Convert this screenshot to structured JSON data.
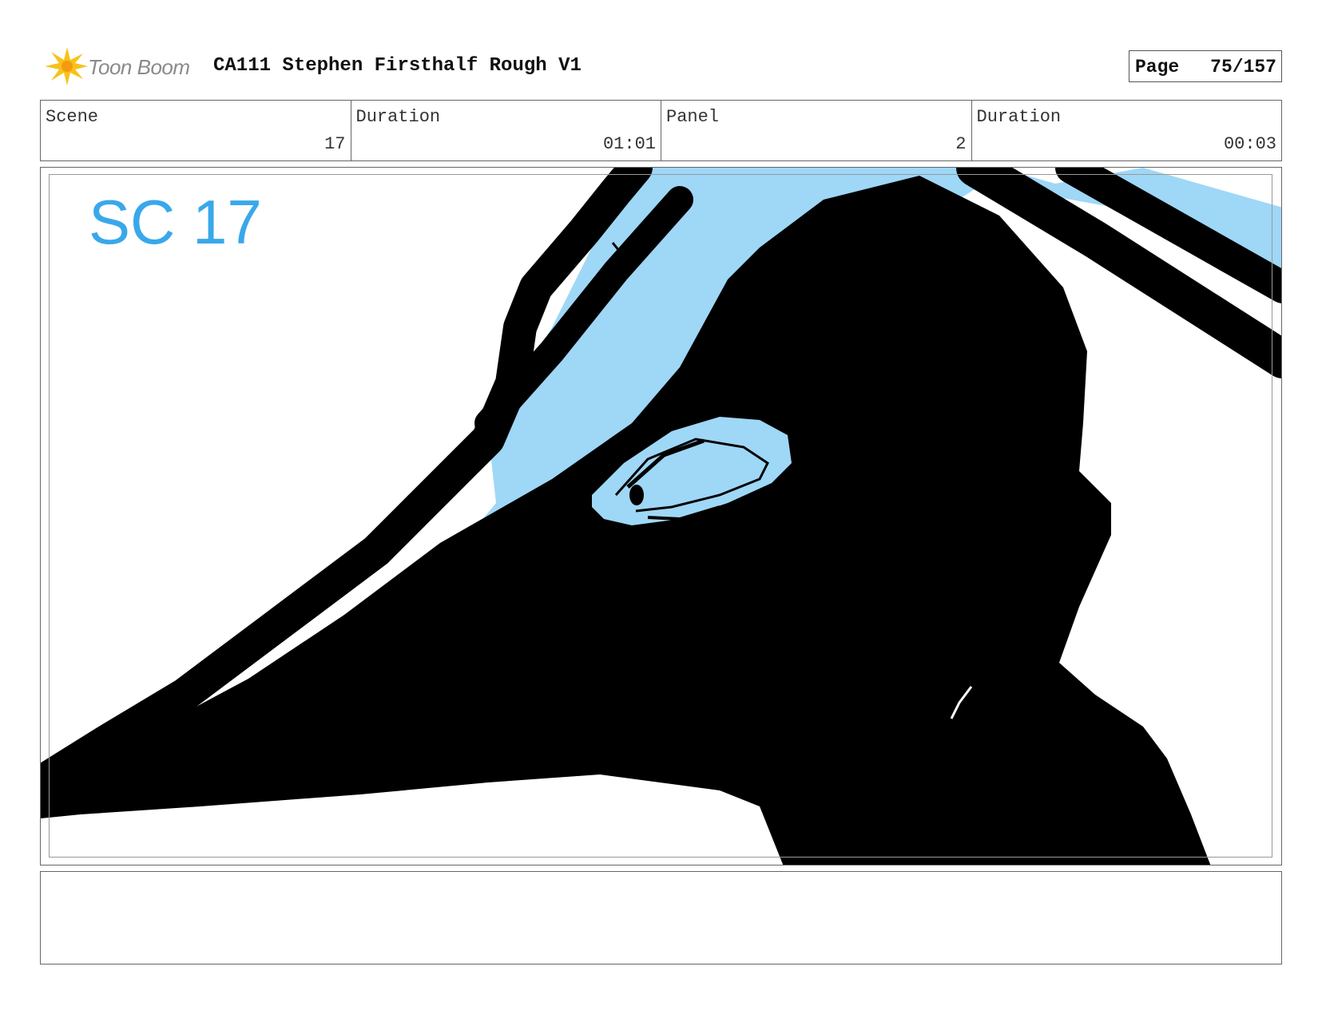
{
  "header": {
    "logo_text": "Toon Boom",
    "title": "CA111 Stephen Firsthalf Rough V1",
    "page_label": "Page",
    "page_value": "75/157"
  },
  "info": {
    "scene_label": "Scene",
    "scene_value": "17",
    "scene_duration_label": "Duration",
    "scene_duration_value": "01:01",
    "panel_label": "Panel",
    "panel_value": "2",
    "panel_duration_label": "Duration",
    "panel_duration_value": "00:03"
  },
  "panel_image": {
    "sketch_label": "SC 17",
    "colors": {
      "ink": "#000000",
      "fill": "#9fd7f7",
      "label": "#39a8ea",
      "paper": "#ffffff"
    }
  },
  "notes": {
    "text": ""
  }
}
